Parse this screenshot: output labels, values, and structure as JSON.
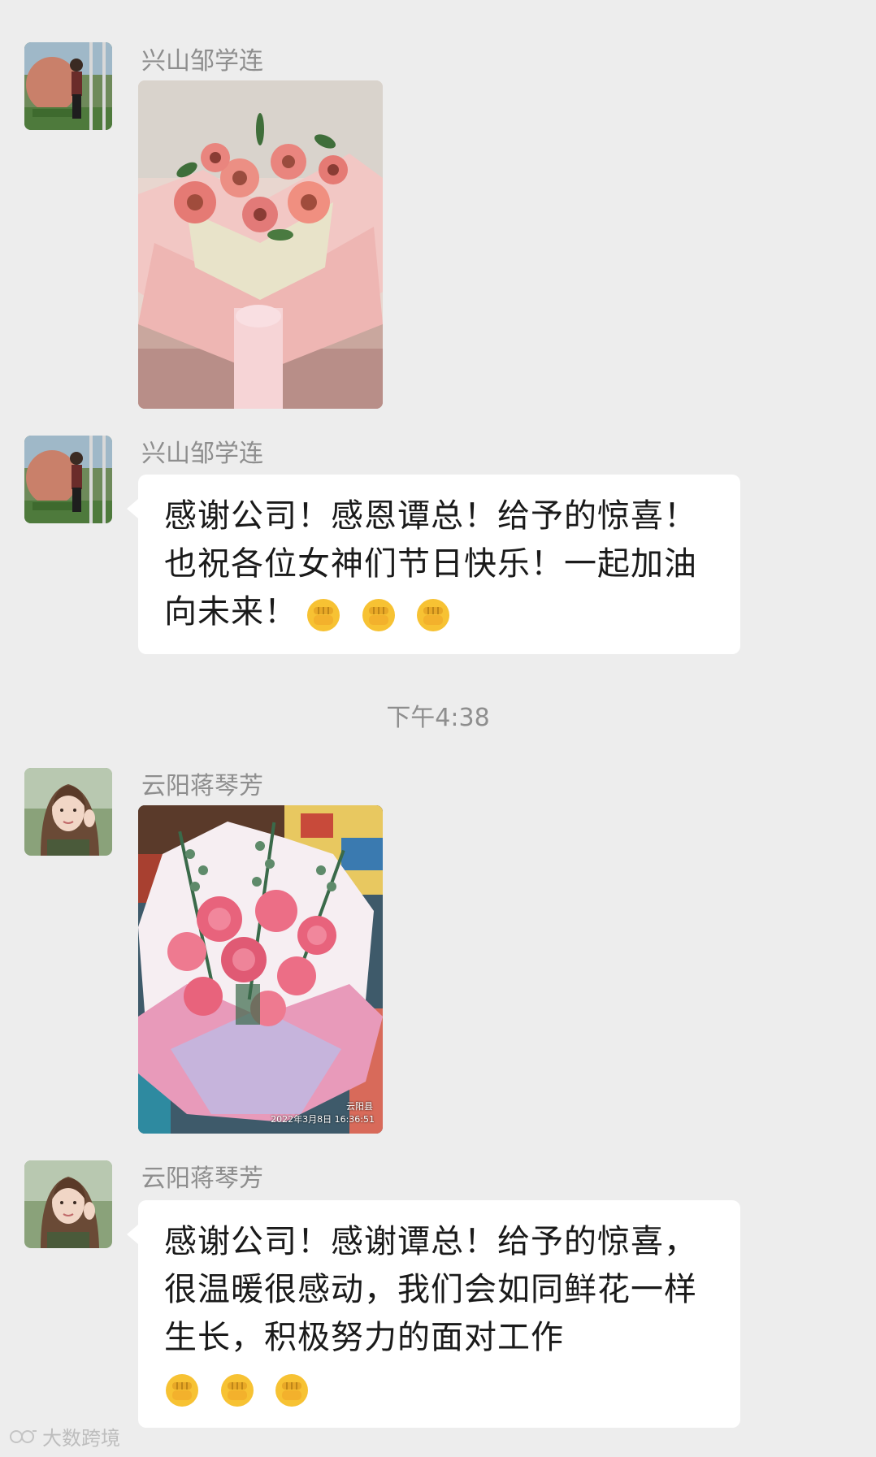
{
  "messages": [
    {
      "sender": "兴山邹学连",
      "type": "image",
      "image_desc": "pink-gerbera-bouquet-photo"
    },
    {
      "sender": "兴山邹学连",
      "type": "text",
      "text": "感谢公司！感恩谭总！给予的惊喜！也祝各位女神们节日快乐！一起加油向未来！",
      "emoji_count": 3
    },
    {
      "sender": "云阳蒋琴芳",
      "type": "image",
      "image_desc": "pink-carnation-bouquet-photo",
      "photo_stamp_location": "云阳县",
      "photo_stamp_time": "2022年3月8日 16:36:51"
    },
    {
      "sender": "云阳蒋琴芳",
      "type": "text",
      "text": "感谢公司！感谢谭总！给予的惊喜，很温暖很感动，我们会如同鲜花一样生长，积极努力的面对工作",
      "emoji_count": 3
    }
  ],
  "timestamp": "下午4:38",
  "watermark": "大数跨境",
  "colors": {
    "background": "#ededed",
    "bubble": "#ffffff",
    "sender_name": "#8e8e8e",
    "emoji_fist": "#f7c233"
  }
}
